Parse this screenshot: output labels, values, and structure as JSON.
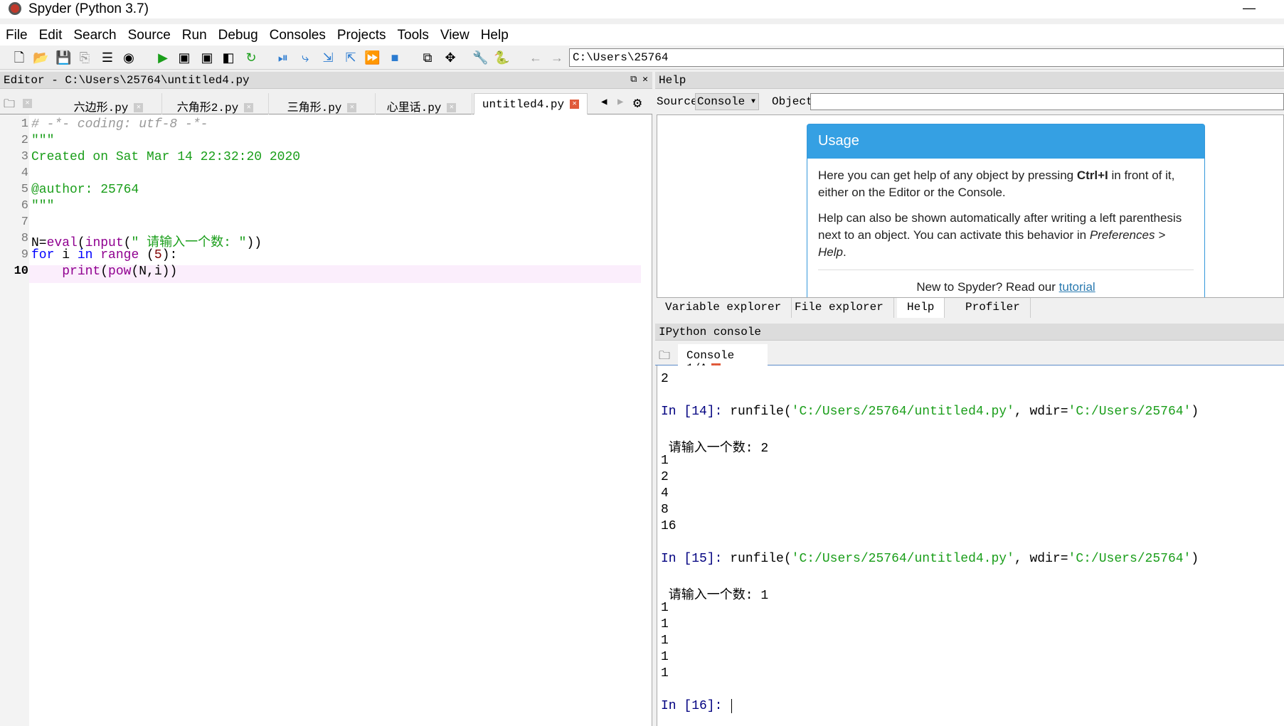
{
  "window": {
    "title": "Spyder (Python 3.7)",
    "minimize": "—"
  },
  "menu": [
    "File",
    "Edit",
    "Search",
    "Source",
    "Run",
    "Debug",
    "Consoles",
    "Projects",
    "Tools",
    "View",
    "Help"
  ],
  "toolbar": {
    "icons": [
      "new-file-icon",
      "open-file-icon",
      "save-icon",
      "save-all-icon",
      "outline-icon",
      "spyder-icon",
      "run-icon",
      "run-cell-icon",
      "run-cell-advance-icon",
      "run-selection-icon",
      "rerun-icon",
      "debug-icon",
      "step-icon",
      "step-into-icon",
      "step-return-icon",
      "continue-icon",
      "stop-icon",
      "maximize-pane-icon",
      "fullscreen-icon",
      "preferences-icon",
      "python-path-icon",
      "back-icon",
      "forward-icon"
    ],
    "path": "C:\\Users\\25764"
  },
  "editor": {
    "header": "Editor - C:\\Users\\25764\\untitled4.py",
    "tabs": [
      {
        "label": "六边形.py"
      },
      {
        "label": "六角形2.py"
      },
      {
        "label": "三角形.py"
      },
      {
        "label": "心里话.py"
      },
      {
        "label": "untitled4.py",
        "active": true
      }
    ],
    "lines": [
      {
        "n": "1",
        "parts": [
          [
            "cm",
            "# -*- coding: utf-8 -*-"
          ]
        ]
      },
      {
        "n": "2",
        "parts": [
          [
            "st",
            "\"\"\""
          ]
        ]
      },
      {
        "n": "3",
        "parts": [
          [
            "st",
            "Created on Sat Mar 14 22:32:20 2020"
          ]
        ]
      },
      {
        "n": "4",
        "parts": []
      },
      {
        "n": "5",
        "parts": [
          [
            "st",
            "@author: 25764"
          ]
        ]
      },
      {
        "n": "6",
        "parts": [
          [
            "st",
            "\"\"\""
          ]
        ]
      },
      {
        "n": "7",
        "parts": []
      },
      {
        "n": "8",
        "parts": [
          [
            "",
            "N="
          ],
          [
            "bi",
            "eval"
          ],
          [
            "",
            "("
          ],
          [
            "bi",
            "input"
          ],
          [
            "",
            "("
          ],
          [
            "st",
            "\" 请输入一个数: \""
          ],
          [
            "",
            "))"
          ]
        ]
      },
      {
        "n": "9",
        "parts": [
          [
            "kw",
            "for"
          ],
          [
            "",
            " i "
          ],
          [
            "kw",
            "in"
          ],
          [
            "",
            " "
          ],
          [
            "bi",
            "range"
          ],
          [
            "",
            " ("
          ],
          [
            "nm",
            "5"
          ],
          [
            "",
            "):"
          ]
        ]
      },
      {
        "n": "10",
        "parts": [
          [
            "",
            "    "
          ],
          [
            "bi",
            "print"
          ],
          [
            "",
            "("
          ],
          [
            "bi",
            "pow"
          ],
          [
            "",
            "(N,i))"
          ]
        ]
      }
    ]
  },
  "help": {
    "header": "Help",
    "source_label": "Source",
    "source_value": "Console",
    "object_label": "Object",
    "object_value": "",
    "usage_title": "Usage",
    "p1a": "Here you can get help of any object by pressing ",
    "p1b": "Ctrl+I",
    "p1c": " in front of it, either on the Editor or the Console.",
    "p2a": "Help can also be shown automatically after writing a left parenthesis next to an object. You can activate this behavior in ",
    "p2b": "Preferences > Help",
    "new_text": "New to Spyder? Read our ",
    "tutorial": "tutorial"
  },
  "bottom_tabs": [
    {
      "label": "Variable explorer"
    },
    {
      "label": "File explorer"
    },
    {
      "label": "Help",
      "active": true
    },
    {
      "label": "Profiler"
    }
  ],
  "console": {
    "header": "IPython console",
    "tab": "Console 1/A",
    "lines": [
      {
        "t": "out",
        "text": "2"
      },
      {
        "t": "out",
        "text": "2"
      },
      {
        "t": "blank"
      },
      {
        "t": "in",
        "prompt": "In [14]: ",
        "code": "runfile(",
        "s1": "'C:/Users/25764/untitled4.py'",
        "mid": ", wdir=",
        "s2": "'C:/Users/25764'",
        "end": ")"
      },
      {
        "t": "blank"
      },
      {
        "t": "out",
        "text": " 请输入一个数: 2"
      },
      {
        "t": "out",
        "text": "1"
      },
      {
        "t": "out",
        "text": "2"
      },
      {
        "t": "out",
        "text": "4"
      },
      {
        "t": "out",
        "text": "8"
      },
      {
        "t": "out",
        "text": "16"
      },
      {
        "t": "blank"
      },
      {
        "t": "in",
        "prompt": "In [15]: ",
        "code": "runfile(",
        "s1": "'C:/Users/25764/untitled4.py'",
        "mid": ", wdir=",
        "s2": "'C:/Users/25764'",
        "end": ")"
      },
      {
        "t": "blank"
      },
      {
        "t": "out",
        "text": " 请输入一个数: 1"
      },
      {
        "t": "out",
        "text": "1"
      },
      {
        "t": "out",
        "text": "1"
      },
      {
        "t": "out",
        "text": "1"
      },
      {
        "t": "out",
        "text": "1"
      },
      {
        "t": "out",
        "text": "1"
      },
      {
        "t": "blank"
      },
      {
        "t": "in",
        "prompt": "In [16]: ",
        "code": "",
        "s1": "",
        "mid": "",
        "s2": "",
        "end": ""
      }
    ]
  }
}
